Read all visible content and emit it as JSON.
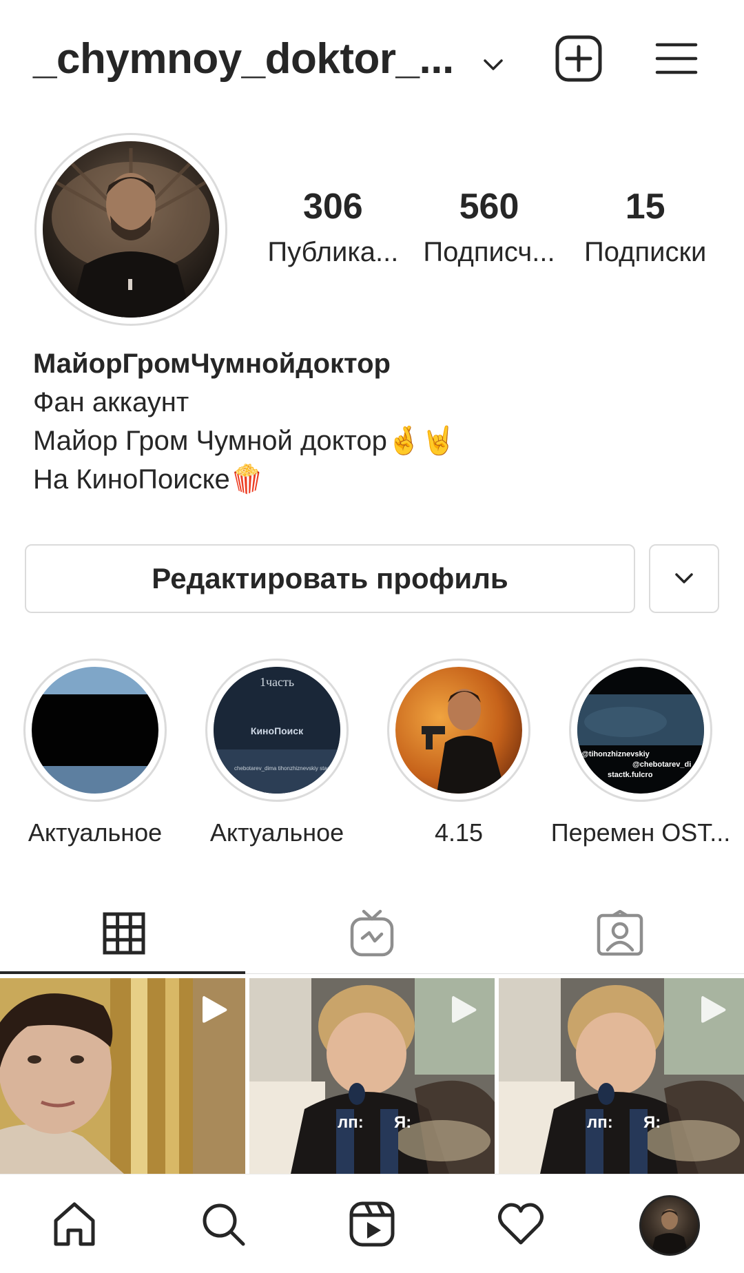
{
  "header": {
    "username": "_chymnoy_doktor_...",
    "icons": {
      "chevron": "chevron-down-icon",
      "new_post": "plus-square-icon",
      "menu": "hamburger-menu-icon"
    }
  },
  "profile": {
    "avatar": "profile-avatar",
    "stats": [
      {
        "value": "306",
        "label": "Публика..."
      },
      {
        "value": "560",
        "label": "Подписч..."
      },
      {
        "value": "15",
        "label": "Подписки"
      }
    ],
    "bio": {
      "name": "МайорГромЧумнойдоктор",
      "lines": [
        "Фан аккаунт",
        "Майор Гром Чумной доктор🤞🤘",
        "На КиноПоиске🍿"
      ]
    }
  },
  "actions": {
    "edit_profile": "Редактировать профиль",
    "more_icon": "chevron-down-icon"
  },
  "highlights": [
    {
      "label": "Актуальное"
    },
    {
      "label": "Актуальное",
      "overlay_top": "1часть",
      "overlay_mid": "КиноПоиск",
      "overlay_bottom": "chebotarev_dima\ntihonzhiznevskiy\nstactk.fulcro"
    },
    {
      "label": "4.15"
    },
    {
      "label": "Перемен OST...",
      "overlay_lines": [
        "@tihonzhiznevskiy",
        "@chebotarev_di",
        "stactk.fulcro"
      ]
    }
  ],
  "tabs": [
    {
      "name": "posts-grid",
      "icon": "grid-icon",
      "active": true
    },
    {
      "name": "igtv",
      "icon": "igtv-icon",
      "active": false
    },
    {
      "name": "tagged",
      "icon": "tagged-person-icon",
      "active": false
    }
  ],
  "grid_posts": [
    {
      "type": "video",
      "caption": ""
    },
    {
      "type": "video",
      "caption_left": "лп:",
      "caption_right": "Я:"
    },
    {
      "type": "video",
      "caption_left": "лп:",
      "caption_right": "Я:"
    }
  ],
  "bottom_nav": [
    {
      "icon": "home-icon"
    },
    {
      "icon": "search-icon"
    },
    {
      "icon": "reels-icon"
    },
    {
      "icon": "heart-icon"
    },
    {
      "icon": "profile-avatar"
    }
  ],
  "colors": {
    "text": "#262626",
    "border": "#dbdbdb",
    "background": "#ffffff"
  }
}
